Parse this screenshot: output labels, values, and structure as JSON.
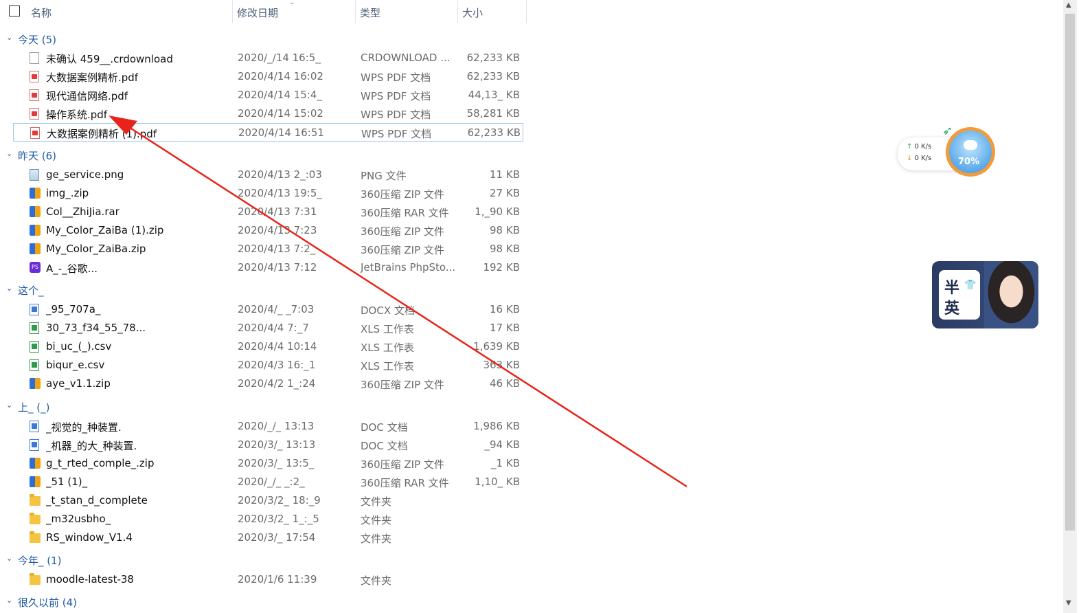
{
  "header": {
    "name": "名称",
    "date": "修改日期",
    "type": "类型",
    "size": "大小"
  },
  "groups": [
    {
      "label": "今天 (5)",
      "rows": [
        {
          "icon": "blank-file-icon",
          "name": "未确认 459__.crdownload",
          "date": "2020/_/14 16:5_",
          "type": "CRDOWNLOAD ...",
          "size": "62,233 KB"
        },
        {
          "icon": "pdf-icon",
          "name": "大数据案例精析.pdf",
          "date": "2020/4/14 16:02",
          "type": "WPS PDF 文档",
          "size": "62,233 KB"
        },
        {
          "icon": "pdf-icon",
          "name": "现代通信网络.pdf",
          "date": "2020/4/14 15:4_",
          "type": "WPS PDF 文档",
          "size": "44,13_ KB"
        },
        {
          "icon": "pdf-icon",
          "name": "操作系统.pdf",
          "date": "2020/4/14 15:02",
          "type": "WPS PDF 文档",
          "size": "58,281 KB"
        },
        {
          "icon": "pdf-icon",
          "name": "大数据案例精析 (1).pdf",
          "date": "2020/4/14 16:51",
          "type": "WPS PDF 文档",
          "size": "62,233 KB"
        }
      ]
    },
    {
      "label": "昨天 (6)",
      "rows": [
        {
          "icon": "image-file-icon",
          "name": "ge_service.png",
          "date": "2020/4/13 2_:03",
          "type": "PNG 文件",
          "size": "11 KB"
        },
        {
          "icon": "zip-archive-icon",
          "name": "img_.zip",
          "date": "2020/4/13 19:5_",
          "type": "360压缩 ZIP 文件",
          "size": "27 KB"
        },
        {
          "icon": "zip-archive-icon",
          "name": "Col__ZhiJia.rar",
          "date": "2020/4/13 7:31",
          "type": "360压缩 RAR 文件",
          "size": "1,_90 KB"
        },
        {
          "icon": "zip-archive-icon",
          "name": "My_Color_ZaiBa (1).zip",
          "date": "2020/4/13 7:23",
          "type": "360压缩 ZIP 文件",
          "size": "98 KB"
        },
        {
          "icon": "zip-archive-icon",
          "name": "My_Color_ZaiBa.zip",
          "date": "2020/4/13 7:2_",
          "type": "360压缩 ZIP 文件",
          "size": "98 KB"
        },
        {
          "icon": "photoshop-icon",
          "name": "A_-_谷歌...",
          "date": "2020/4/13 7:12",
          "type": "JetBrains PhpSto...",
          "size": "192 KB"
        }
      ]
    },
    {
      "label": "这个_",
      "rows": [
        {
          "icon": "word-doc-icon",
          "name": "_95_707a_",
          "date": "2020/4/_ _7:03",
          "type": "DOCX 文档",
          "size": "16 KB"
        },
        {
          "icon": "excel-icon",
          "name": "30_73_f34_55_78...",
          "date": "2020/4/4 7:_7",
          "type": "XLS 工作表",
          "size": "17 KB"
        },
        {
          "icon": "excel-icon",
          "name": "bi_uc_(_).csv",
          "date": "2020/4/4 10:14",
          "type": "XLS 工作表",
          "size": "1,639 KB"
        },
        {
          "icon": "excel-icon",
          "name": "biqur_e.csv",
          "date": "2020/4/3 16:_1",
          "type": "XLS 工作表",
          "size": "363 KB"
        },
        {
          "icon": "zip-archive-icon",
          "name": "aye_v1.1.zip",
          "date": "2020/4/2 1_:24",
          "type": "360压缩 ZIP 文件",
          "size": "46 KB"
        }
      ]
    },
    {
      "label": "上_ (_)",
      "rows": [
        {
          "icon": "word-doc-icon",
          "name": "_视觉的_种装置.",
          "date": "2020/_/_ 13:13",
          "type": "DOC 文档",
          "size": "1,986 KB"
        },
        {
          "icon": "word-doc-icon",
          "name": "_机器_的大_种装置.",
          "date": "2020/3/_ 13:13",
          "type": "DOC 文档",
          "size": "_94 KB"
        },
        {
          "icon": "zip-archive-icon",
          "name": "g_t_rted_comple_.zip",
          "date": "2020/3/_ 13:5_",
          "type": "360压缩 ZIP 文件",
          "size": "_1 KB"
        },
        {
          "icon": "zip-archive-icon",
          "name": "_51 (1)_",
          "date": "2020/_/_ _:2_",
          "type": "360压缩 RAR 文件",
          "size": "1,10_ KB"
        },
        {
          "icon": "folder-icon",
          "name": "_t_stan_d_complete",
          "date": "2020/3/2_ 18:_9",
          "type": "文件夹",
          "size": ""
        },
        {
          "icon": "folder-icon",
          "name": "_m32usbho_",
          "date": "2020/3/2_ 1_:_5",
          "type": "文件夹",
          "size": ""
        },
        {
          "icon": "folder-icon",
          "name": "RS_window_V1.4",
          "date": "2020/3/_ 17:54",
          "type": "文件夹",
          "size": ""
        }
      ]
    },
    {
      "label": "今年_ (1)",
      "rows": [
        {
          "icon": "folder-icon",
          "name": "moodle-latest-38",
          "date": "2020/1/6 11:39",
          "type": "文件夹",
          "size": ""
        }
      ]
    },
    {
      "label": "很久以前 (4)",
      "rows": []
    }
  ],
  "netwidget": {
    "up": "0 K/s",
    "down": "0 K/s",
    "percent": "70%"
  },
  "ad": {
    "char1": "半",
    "char2": "英"
  }
}
